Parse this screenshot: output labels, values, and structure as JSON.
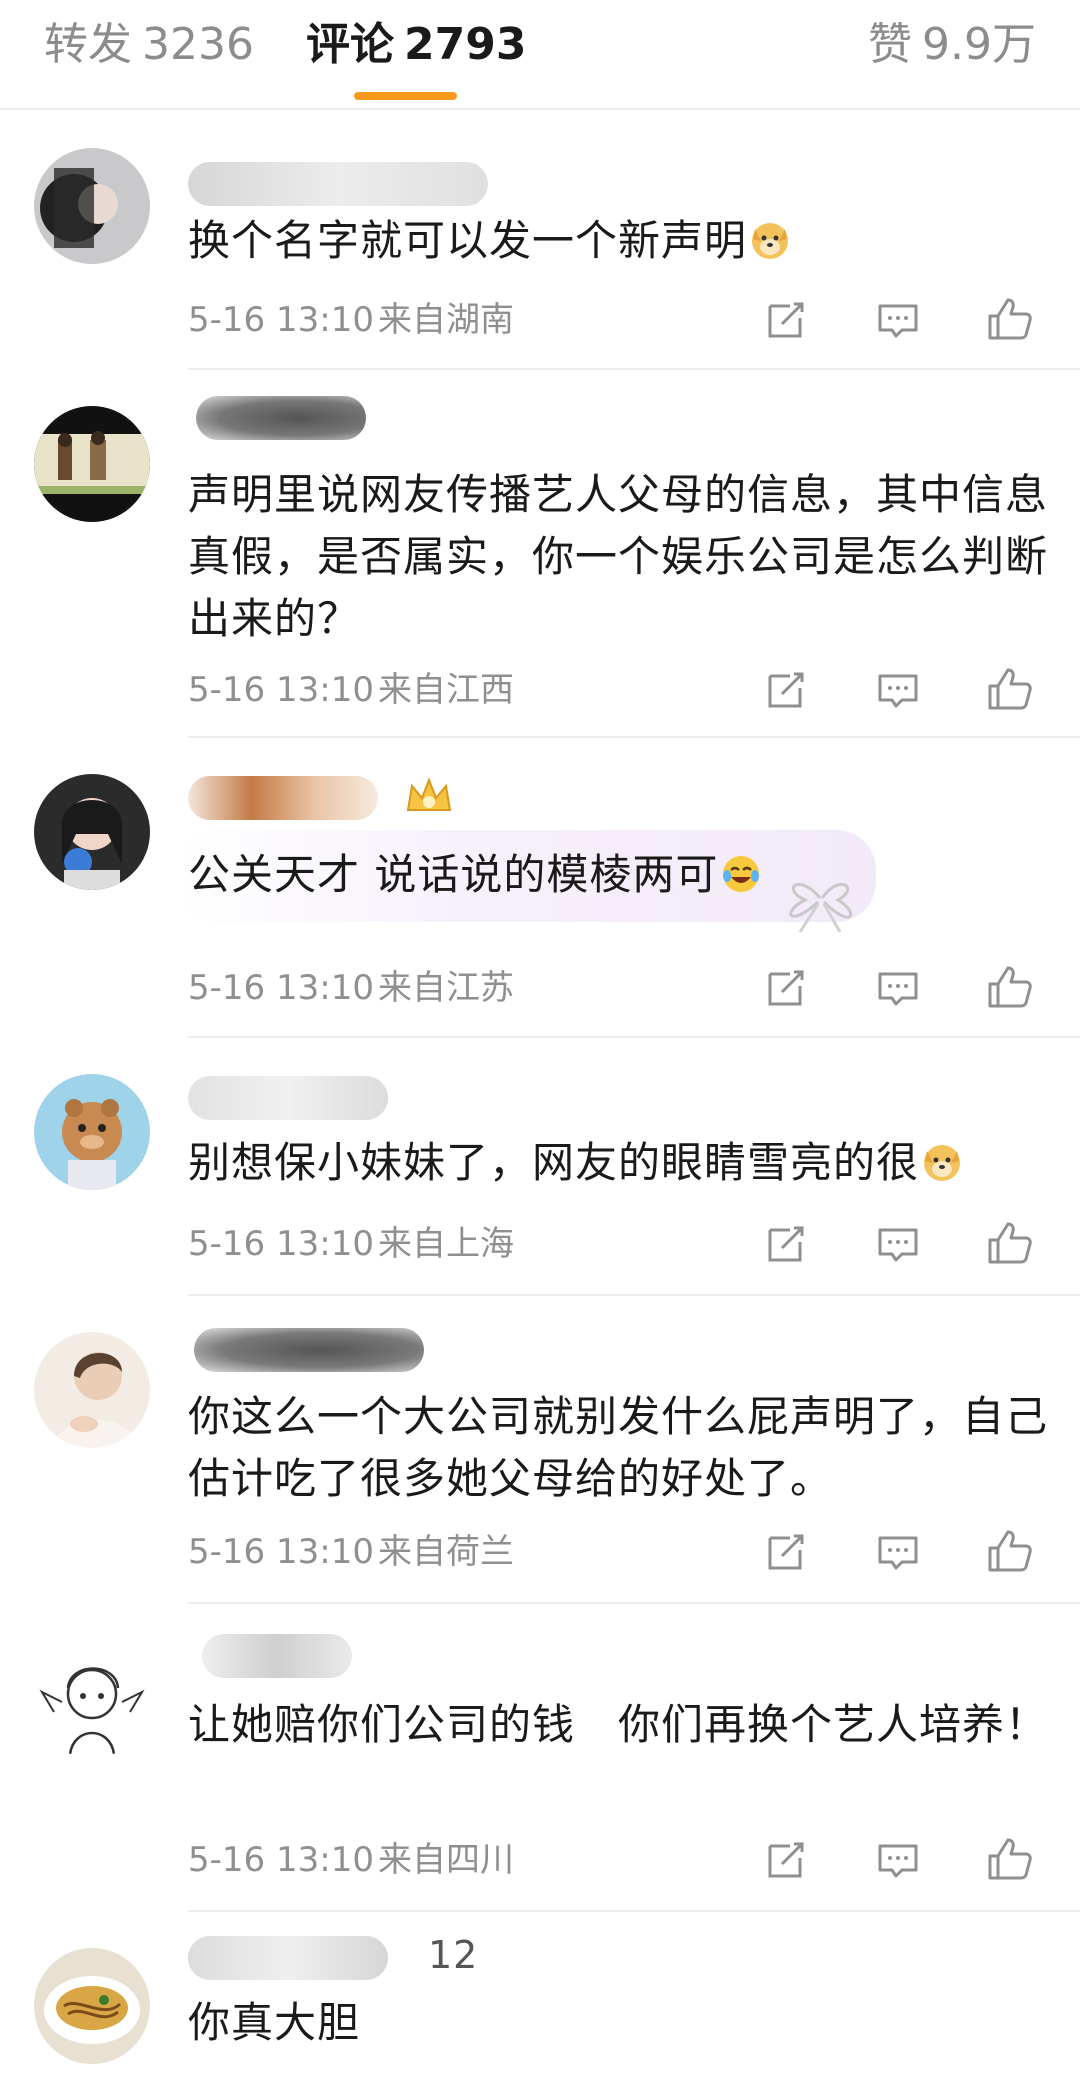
{
  "tabs": {
    "repost": {
      "label": "转发",
      "count": "3236"
    },
    "comments": {
      "label": "评论",
      "count": "2793"
    },
    "likes": {
      "label": "赞",
      "count": "9.9万"
    }
  },
  "accent_color": "#f59a1f",
  "comments": [
    {
      "username": "",
      "text": "换个名字就可以发一个新声明",
      "emoji": "doge-icon",
      "time": "5-16 13:10",
      "location": "来自湖南"
    },
    {
      "username": "",
      "text": "声明里说网友传播艺人父母的信息，其中信息真假，是否属实，你一个娱乐公司是怎么判断出来的？",
      "time": "5-16 13:10",
      "location": "来自江西"
    },
    {
      "username": "",
      "text": "公关天才 说话说的模棱两可",
      "emoji": "laugh-cry-icon",
      "time": "5-16 13:10",
      "location": "来自江苏"
    },
    {
      "username": "",
      "text": "别想保小妹妹了，网友的眼睛雪亮的很",
      "emoji": "doge-icon",
      "time": "5-16 13:10",
      "location": "来自上海"
    },
    {
      "username": "",
      "text": "你这么一个大公司就别发什么屁声明了，自己估计吃了很多她父母给的好处了。",
      "time": "5-16 13:10",
      "location": "来自荷兰"
    },
    {
      "username": "",
      "text": "让她赔你们公司的钱　你们再换个艺人培养！",
      "time": "5-16 13:10",
      "location": "来自四川"
    },
    {
      "username": "12",
      "text": "你真大胆"
    }
  ]
}
